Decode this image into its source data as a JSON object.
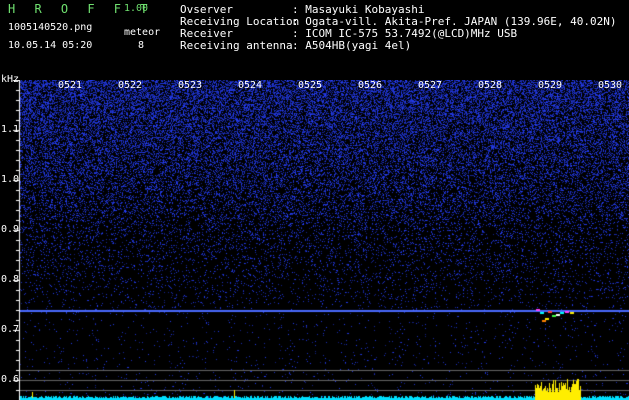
{
  "app": {
    "title": "H R O F F T",
    "version": "1.00"
  },
  "file": {
    "name": "1005140520.png",
    "datetime": "10.05.14 05:20"
  },
  "meteor": {
    "label": "meteor",
    "count": "8"
  },
  "info": [
    {
      "label": "Ovserver",
      "value": ": Masayuki Kobayashi"
    },
    {
      "label": "Receiving Location",
      "value": ": Ogata-vill. Akita-Pref. JAPAN (139.96E, 40.02N)"
    },
    {
      "label": "Receiver",
      "value": ": ICOM IC-575 53.7492(@LCD)MHz USB"
    },
    {
      "label": "Receiving antenna",
      "value": ": A504HB(yagi 4el)"
    }
  ],
  "axis": {
    "unit": "kHz",
    "y_labels": [
      "1.1",
      "1.0",
      "0.9",
      "0.8",
      "0.7",
      "0.6"
    ],
    "time_ticks": [
      "0521",
      "0522",
      "0523",
      "0524",
      "0525",
      "0526",
      "0527",
      "0528",
      "0529",
      "0530"
    ]
  },
  "colors": {
    "noise": "#2a3cff",
    "carrier": "#4a6aff",
    "level": "#00e0ff",
    "meteor": "#ffee00",
    "label": "#6fe06f"
  }
}
